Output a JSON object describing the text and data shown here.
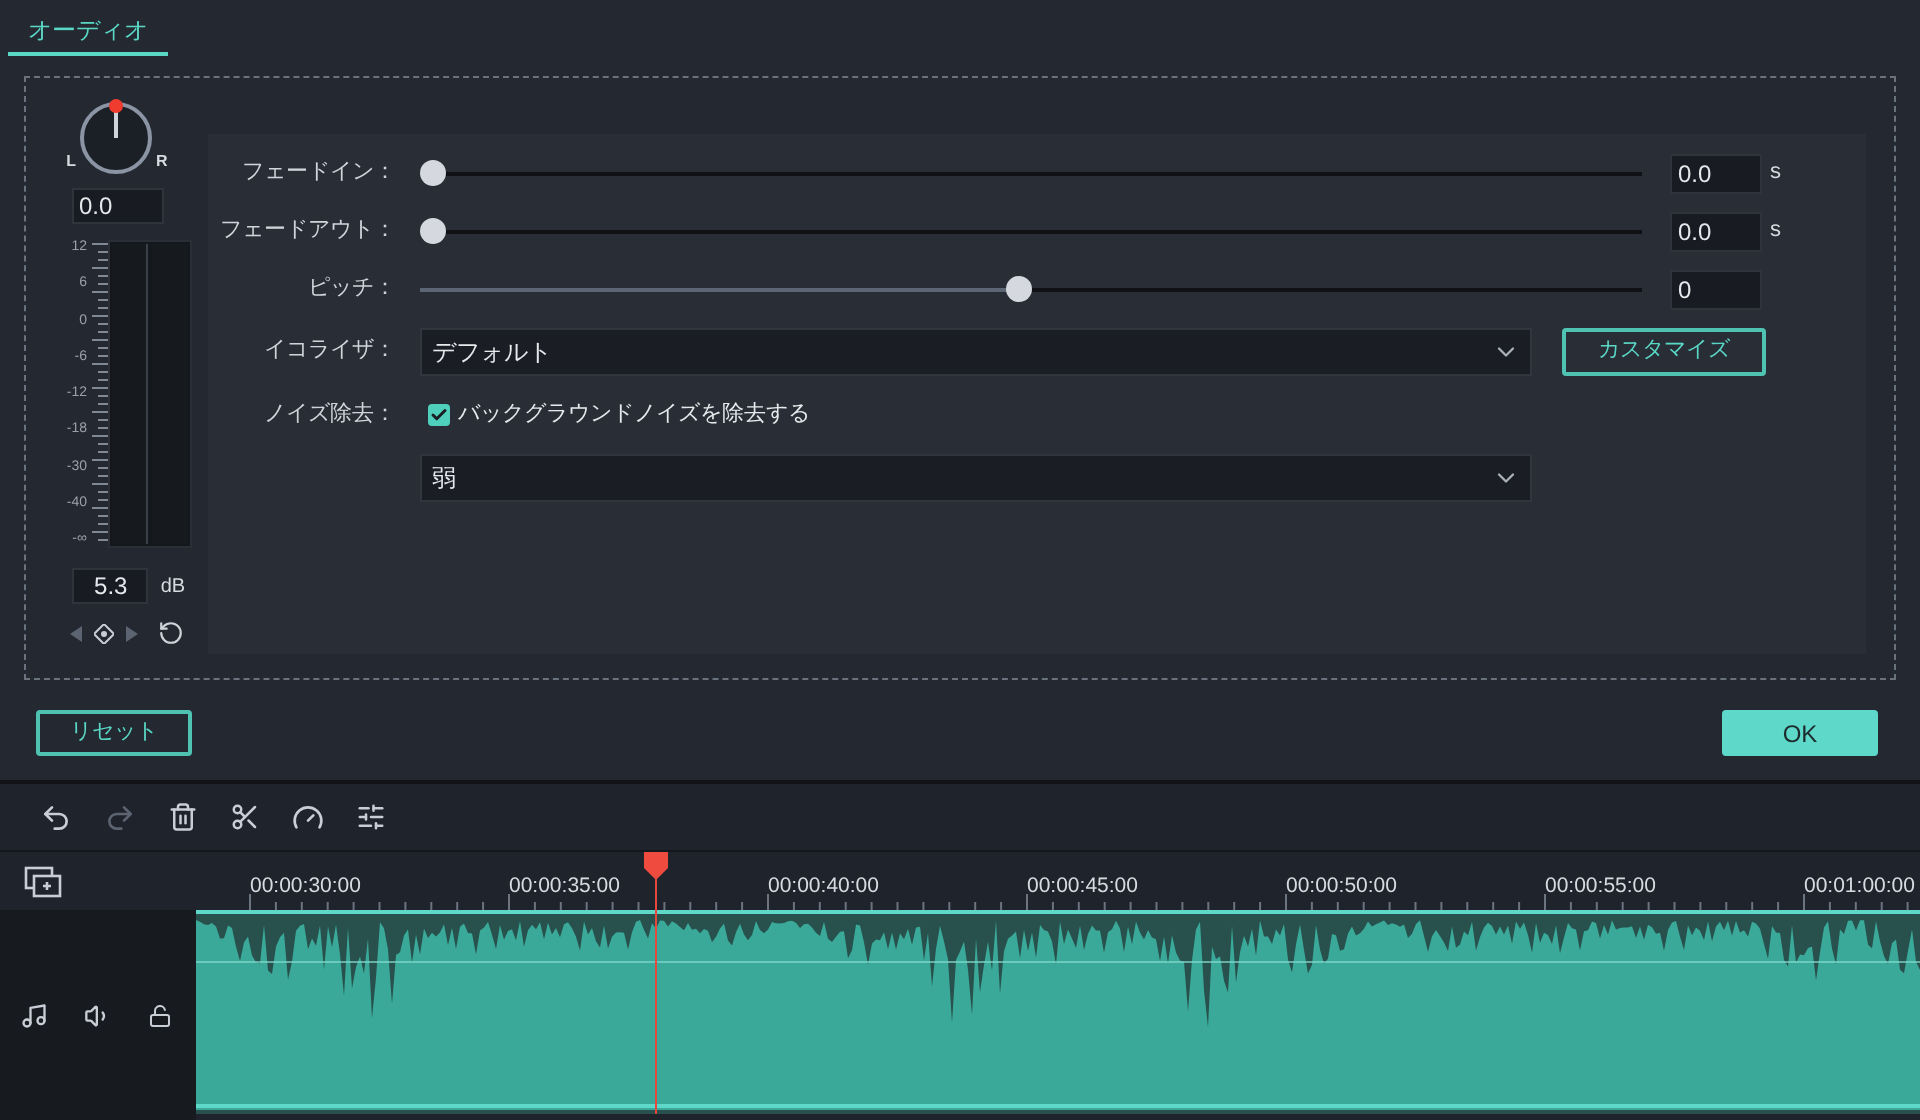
{
  "tabs": [
    {
      "label": "オーディオ",
      "selected": true
    }
  ],
  "pan": {
    "left_label": "L",
    "right_label": "R",
    "value": "0.0"
  },
  "meter": {
    "scale": [
      "12",
      "6",
      "0",
      "-6",
      "-12",
      "-18",
      "-30",
      "-40",
      "-∞"
    ],
    "value": "5.3",
    "unit": "dB"
  },
  "settings": [
    {
      "kind": "slider",
      "label": "フェードイン：",
      "level": 0,
      "value": "0.0",
      "unit": "s"
    },
    {
      "kind": "slider",
      "label": "フェードアウト：",
      "level": 0,
      "value": "0.0",
      "unit": "s"
    },
    {
      "kind": "slider",
      "label": "ピッチ：",
      "level": 0.49,
      "value": "0"
    },
    {
      "kind": "dropdown",
      "label": "イコライザ：",
      "value": "デフォルト",
      "button": "カスタマイズ"
    },
    {
      "kind": "noise",
      "label": "ノイズ除去：",
      "checkbox": {
        "label": "バックグラウンドノイズを除去する",
        "checked": true
      },
      "value": "弱"
    }
  ],
  "buttons": {
    "reset": "リセット",
    "ok": "OK"
  },
  "timeline": {
    "ruler": [
      "00:00:30:00",
      "00:00:35:00",
      "00:00:40:00",
      "00:00:45:00",
      "00:00:50:00",
      "00:00:55:00",
      "00:01:00:00"
    ]
  }
}
